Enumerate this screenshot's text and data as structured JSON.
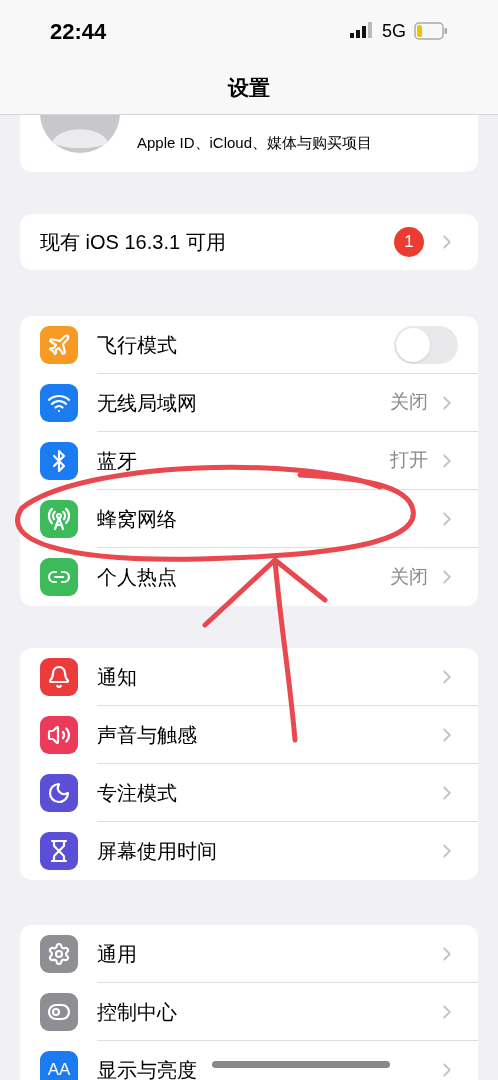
{
  "status_bar": {
    "time": "22:44",
    "network": "5G"
  },
  "title": "设置",
  "account": {
    "subtitle": "Apple ID、iCloud、媒体与购买项目"
  },
  "update": {
    "label": "现有 iOS 16.3.1 可用",
    "badge": "1"
  },
  "groups": [
    {
      "rows": [
        {
          "kind": "toggle",
          "label": "飞行模式",
          "color": "#f59a23",
          "on": false
        },
        {
          "kind": "link",
          "label": "无线局域网",
          "color": "#1a7cf0",
          "value": "关闭"
        },
        {
          "kind": "link",
          "label": "蓝牙",
          "color": "#1a7cf0",
          "value": "打开"
        },
        {
          "kind": "link",
          "label": "蜂窝网络",
          "color": "#3dbb5a"
        },
        {
          "kind": "link",
          "label": "个人热点",
          "color": "#3dbb5a",
          "value": "关闭"
        }
      ]
    },
    {
      "rows": [
        {
          "kind": "link",
          "label": "通知",
          "color": "#ec3b3b"
        },
        {
          "kind": "link",
          "label": "声音与触感",
          "color": "#ec3a5a"
        },
        {
          "kind": "link",
          "label": "专注模式",
          "color": "#5a4fd6"
        },
        {
          "kind": "link",
          "label": "屏幕使用时间",
          "color": "#5a4fd6"
        }
      ]
    },
    {
      "rows": [
        {
          "kind": "link",
          "label": "通用",
          "color": "#8e8e93"
        },
        {
          "kind": "link",
          "label": "控制中心",
          "color": "#8e8e93"
        },
        {
          "kind": "link",
          "label": "显示与亮度",
          "color": "#1a7cf0",
          "icon_text": "AA"
        }
      ]
    }
  ]
}
